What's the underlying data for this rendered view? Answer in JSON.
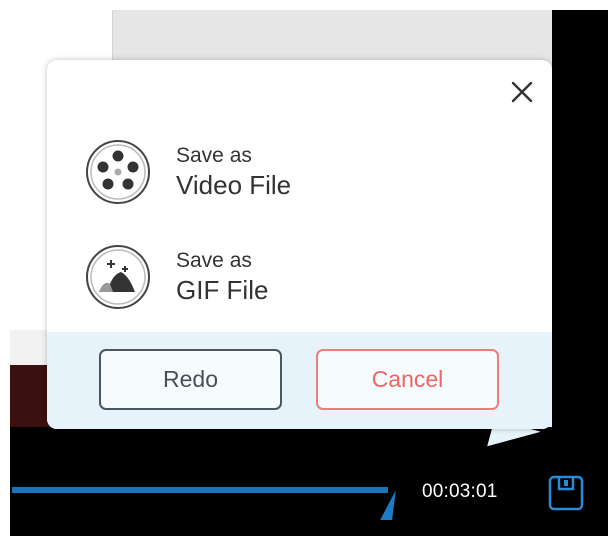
{
  "dialog": {
    "close_icon": "close-icon",
    "options": [
      {
        "line1": "Save as",
        "line2": "Video File",
        "icon": "film-reel-icon"
      },
      {
        "line1": "Save as",
        "line2": "GIF File",
        "icon": "gif-image-icon"
      }
    ],
    "buttons": {
      "redo": "Redo",
      "cancel": "Cancel"
    }
  },
  "player": {
    "timecode": "00:03:01",
    "save_icon": "save-icon"
  },
  "colors": {
    "accent_blue": "#1e74b8",
    "cancel_red": "#ef6464",
    "footer_bg": "#e6f3fb"
  }
}
